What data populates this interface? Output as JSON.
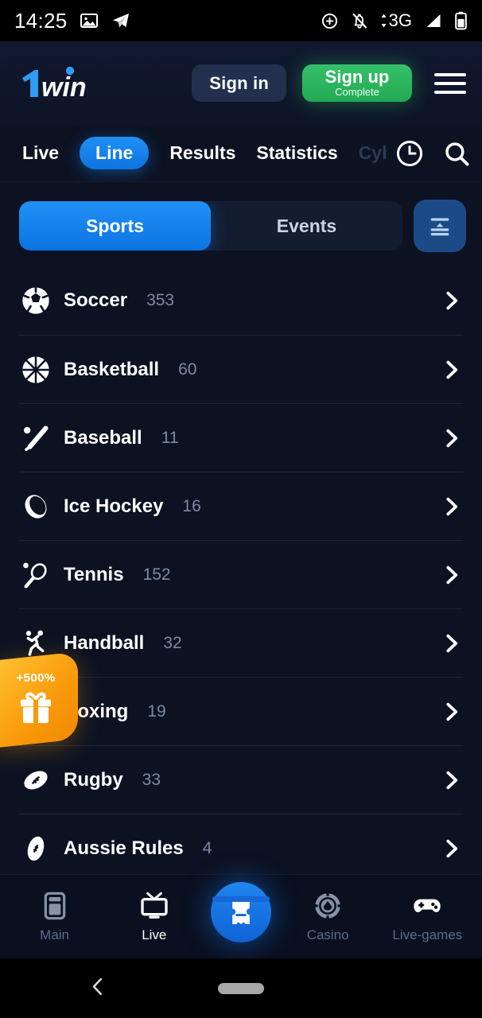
{
  "status_bar": {
    "time": "14:25",
    "left_icons": [
      "image-icon",
      "telegram-icon"
    ],
    "right_icons": [
      "location-icon",
      "bell-off-icon",
      "signal-3g-icon",
      "signal-bars-icon",
      "battery-icon"
    ],
    "network_label": "3G"
  },
  "header": {
    "logo_text": "1win",
    "sign_in_label": "Sign in",
    "sign_up_label": "Sign up",
    "sign_up_sublabel": "Complete",
    "menu_icon": "hamburger-menu-icon"
  },
  "top_nav": {
    "items": [
      {
        "label": "Live",
        "active": false
      },
      {
        "label": "Line",
        "active": true
      },
      {
        "label": "Results",
        "active": false
      },
      {
        "label": "Statistics",
        "active": false
      },
      {
        "label": "Cyb",
        "active": false,
        "faded": true
      }
    ],
    "icons": [
      "clock-icon",
      "search-icon"
    ]
  },
  "segment": {
    "sports_label": "Sports",
    "events_label": "Events",
    "active": "Sports",
    "filter_icon": "sort-filter-icon"
  },
  "sports": [
    {
      "name": "Soccer",
      "count": "353",
      "icon": "soccer-ball-icon"
    },
    {
      "name": "Basketball",
      "count": "60",
      "icon": "basketball-icon"
    },
    {
      "name": "Baseball",
      "count": "11",
      "icon": "baseball-bat-icon"
    },
    {
      "name": "Ice Hockey",
      "count": "16",
      "icon": "hockey-puck-icon"
    },
    {
      "name": "Tennis",
      "count": "152",
      "icon": "tennis-racket-icon"
    },
    {
      "name": "Handball",
      "count": "32",
      "icon": "handball-player-icon"
    },
    {
      "name": "Boxing",
      "count": "19",
      "icon": "boxing-glove-icon"
    },
    {
      "name": "Rugby",
      "count": "33",
      "icon": "rugby-ball-icon"
    },
    {
      "name": "Aussie Rules",
      "count": "4",
      "icon": "aussie-rules-ball-icon"
    }
  ],
  "promo": {
    "bonus_text": "+500%",
    "icon": "gift-box-icon"
  },
  "bottom_nav": {
    "items": [
      {
        "label": "Main",
        "icon": "main-screen-icon",
        "active": false
      },
      {
        "label": "Live",
        "icon": "tv-icon",
        "active": true
      },
      {
        "label": "Casino",
        "icon": "casino-chip-icon",
        "active": false
      },
      {
        "label": "Live-games",
        "icon": "gamepad-icon",
        "active": false
      }
    ],
    "center_icon": "betslip-ticket-icon"
  },
  "system_nav": {
    "back_icon": "back-chevron-icon",
    "home_icon": "home-pill-icon"
  },
  "colors": {
    "accent_blue": "#1f86ef",
    "accent_green": "#2dbe5f",
    "promo_orange": "#f99a0a",
    "background": "#0c1222",
    "muted_text": "#7b8aa6"
  }
}
